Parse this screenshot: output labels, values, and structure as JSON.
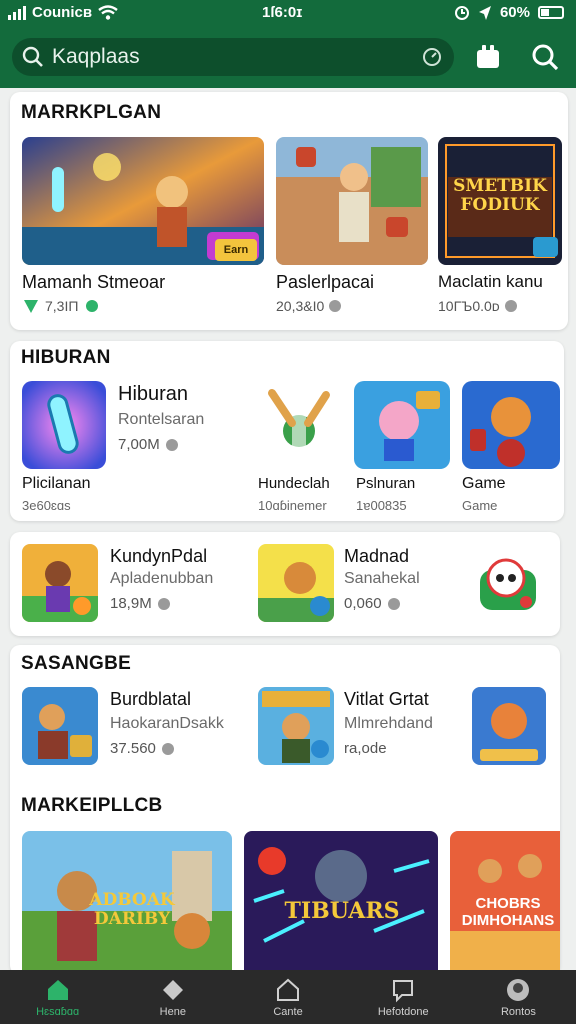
{
  "status_bar": {
    "carrier": "Counicʙ",
    "time": "1ſ6:0ɪ",
    "battery": "60%"
  },
  "header": {
    "search_value": "Kaqplaas",
    "icons": [
      "search-icon",
      "mic-icon",
      "store-icon",
      "search-icon"
    ]
  },
  "colors": {
    "brand_green": "#136b3c",
    "nav_dark": "#2a2a2a",
    "nav_active": "#2db36a"
  },
  "section1": {
    "title": "MARRKPLGAN",
    "items": [
      {
        "name": "Mamanh Stmeoar",
        "meta": "7,3IΠ",
        "badge": "Earn"
      },
      {
        "name": "Paslerlpacai",
        "meta": "20,3&I0"
      },
      {
        "name": "Maclatin kanu",
        "meta": "10ΓЪ0.0ᴅ",
        "banner": "SMETBIK FODIUK"
      }
    ]
  },
  "section2": {
    "title": "HIBURAN",
    "featured": {
      "name": "Hiburan",
      "sub": "Rontelsaran",
      "size": "7,00M"
    },
    "small": [
      {
        "name": "Plicilanan",
        "size": "3е60ɛɑs"
      },
      {
        "name": "Hundeclah",
        "size": "10ɑɓinemer"
      },
      {
        "name": "Pslnuran",
        "size": "1ɐ00835"
      },
      {
        "name": "Game",
        "size": "Game"
      }
    ]
  },
  "section3": {
    "items": [
      {
        "name": "KundynPdal",
        "sub": "Apladenubban",
        "size": "18,9M"
      },
      {
        "name": "Madnad",
        "sub": "Sanahekal",
        "size": "0,060"
      }
    ]
  },
  "section4": {
    "title": "SASANGBE",
    "items": [
      {
        "name": "Burdblatal",
        "sub": "HaokaranDsakk",
        "size": "37.560"
      },
      {
        "name": "Vitlat Grtat",
        "sub": "Mlmrehdand",
        "size": "ra,ode"
      }
    ]
  },
  "section5": {
    "title": "MARKEIPLLCB",
    "banners": [
      "ADBOAK DARIBY",
      "TIBUARS",
      "CHOBRS DIMHOHANS"
    ]
  },
  "bottom_nav": [
    {
      "label": "Hɛsɑɓɑɑ",
      "icon": "home-icon",
      "active": true
    },
    {
      "label": "Hene",
      "icon": "tag-icon",
      "active": false
    },
    {
      "label": "Cante",
      "icon": "house-outline-icon",
      "active": false
    },
    {
      "label": "Hefotdone",
      "icon": "chat-icon",
      "active": false
    },
    {
      "label": "Rontos",
      "icon": "profile-icon",
      "active": false
    }
  ]
}
